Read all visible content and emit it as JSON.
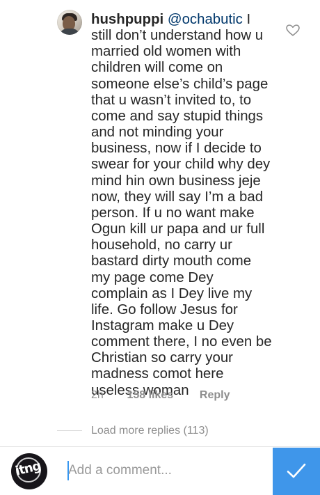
{
  "comment": {
    "username": "hushpuppi",
    "mention": "@ochabutic",
    "text": " I still don’t understand how u married old women with children will come on someone else’s child’s page that u wasn’t invited to, to come and say stupid things and not minding your business, now if I decide to swear for your child why dey mind hin own business jeje now, they will say I’m a bad person. If u no want make Ogun kill ur papa and ur full household, no carry ur bastard dirty mouth come my page come Dey complain as I Dey live my life. Go follow Jesus for Instagram make u Dey comment there, I no even be Christian so carry your madness comot here useless woman",
    "time": "2h",
    "likes": "158 likes",
    "reply": "Reply",
    "heart_icon": "heart-outline-icon"
  },
  "replies": {
    "load_more": "Load more replies (113)"
  },
  "composer": {
    "placeholder": "Add a comment...",
    "avatar_label": "itng",
    "send_icon": "checkmark-icon"
  },
  "colors": {
    "text": "#262626",
    "mention": "#00376b",
    "muted": "#8e8e8e",
    "accent": "#3f96ea"
  }
}
